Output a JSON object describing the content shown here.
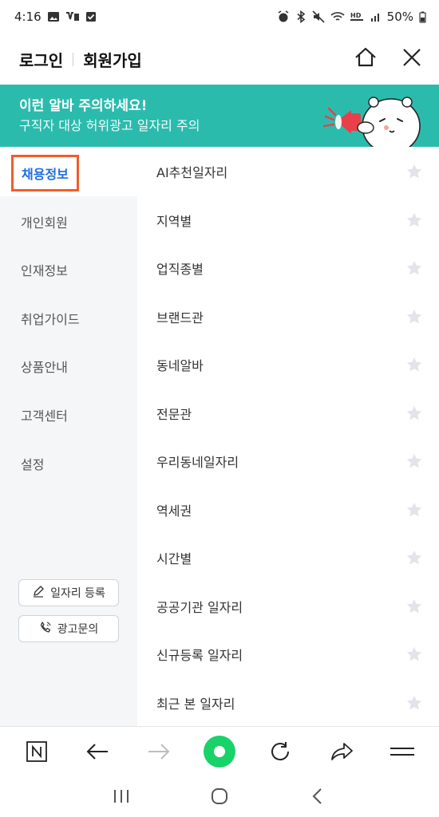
{
  "status_bar": {
    "time": "4:16",
    "battery": "50%"
  },
  "header": {
    "login": "로그인",
    "signup": "회원가입",
    "icons": [
      "home-icon",
      "close-icon"
    ]
  },
  "banner": {
    "title": "이런 알바 주의하세요!",
    "subtitle": "구직자 대상 허위광고 일자리 주의"
  },
  "sidebar": {
    "active": "채용정보",
    "items": [
      "개인회원",
      "인재정보",
      "취업가이드",
      "상품안내",
      "고객센터",
      "설정"
    ],
    "buttons": {
      "register_job": "일자리 등록",
      "ad_inquiry": "광고문의"
    }
  },
  "menu": {
    "items": [
      "AI추천일자리",
      "지역별",
      "업직종별",
      "브랜드관",
      "동네알바",
      "전문관",
      "우리동네일자리",
      "역세권",
      "시간별",
      "공공기관 일자리",
      "신규등록 일자리",
      "최근 본 일자리"
    ]
  },
  "colors": {
    "banner": "#2bbbad",
    "active_text": "#1e6de0",
    "highlight_border": "#f25c2a",
    "fab": "#19d26a"
  }
}
